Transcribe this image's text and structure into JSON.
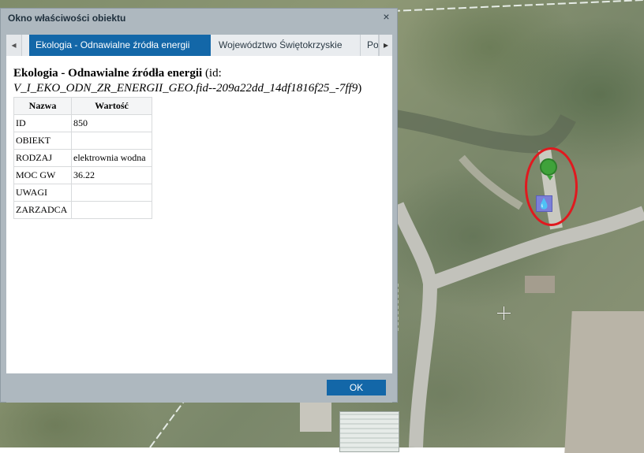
{
  "window": {
    "title": "Okno właściwości obiektu",
    "close_glyph": "×"
  },
  "tabs": {
    "scroll_left_glyph": "◂",
    "scroll_right_glyph": "▸",
    "items": [
      {
        "label": "Ekologia - Odnawialne źródła energii",
        "active": true
      },
      {
        "label": "Województwo Świętokrzyskie",
        "active": false
      },
      {
        "label": "Po",
        "active": false
      }
    ]
  },
  "feature": {
    "title": "Ekologia - Odnawialne źródła energii",
    "id_prefix": " (id:",
    "id": "V_I_EKO_ODN_ZR_ENERGII_GEO.fid--209a22dd_14df1816f25_-7ff9",
    "id_suffix": ")"
  },
  "table": {
    "headers": [
      "Nazwa",
      "Wartość"
    ],
    "rows": [
      {
        "name": "ID",
        "value": "850"
      },
      {
        "name": "OBIEKT",
        "value": ""
      },
      {
        "name": "RODZAJ",
        "value": "elektrownia wodna"
      },
      {
        "name": "MOC GW",
        "value": "36.22"
      },
      {
        "name": "UWAGI",
        "value": ""
      },
      {
        "name": "ZARZADCA",
        "value": ""
      }
    ]
  },
  "footer": {
    "ok_label": "OK"
  },
  "map": {
    "markers": [
      {
        "icon": "green-energy-marker-icon",
        "color": "#3fa23a"
      },
      {
        "icon": "water-drop-marker-icon",
        "color": "#7b7fd8",
        "glyph": "💧"
      }
    ],
    "highlight_color": "#e0191f"
  }
}
